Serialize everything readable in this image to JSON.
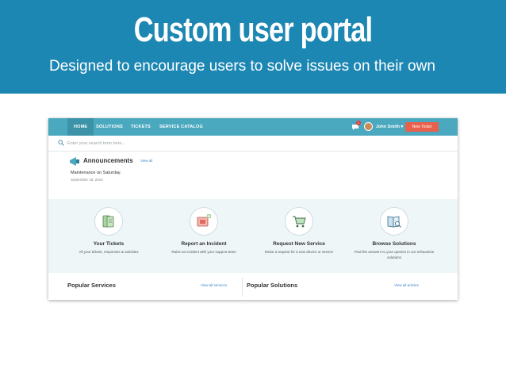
{
  "slide": {
    "title": "Custom user portal",
    "subtitle": "Designed to encourage users to solve issues on their own"
  },
  "portal": {
    "nav": {
      "items": [
        "HOME",
        "SOLUTIONS",
        "TICKETS",
        "SERVICE CATALOG"
      ],
      "active": "HOME",
      "notification_count": "1",
      "user_name": "John Smith ▾",
      "new_ticket_label": "New Ticket"
    },
    "search": {
      "placeholder": "Enter your search term here..."
    },
    "announcements": {
      "title": "Announcements",
      "view_all": "View all",
      "item_title": "Maintenance on Saturday.",
      "item_date": "September 18, 2014"
    },
    "cards": [
      {
        "title": "Your Tickets",
        "desc": "All your tickets, responses & activities",
        "icon": "tickets-icon"
      },
      {
        "title": "Report an Incident",
        "desc": "Raise an incident with your support team",
        "icon": "report-incident-icon"
      },
      {
        "title": "Request New Service",
        "desc": "Raise a request for a new device or service",
        "icon": "cart-icon"
      },
      {
        "title": "Browse Solutions",
        "desc": "Find the answers to your queries in our exhaustive solutions",
        "icon": "book-search-icon"
      }
    ],
    "popular_services": {
      "title": "Popular Services",
      "link": "View all services"
    },
    "popular_solutions": {
      "title": "Popular Solutions",
      "link": "View all articles"
    }
  },
  "colors": {
    "banner": "#1d87b3",
    "nav": "#4aa8bf",
    "new_ticket": "#e8604c",
    "cards_bg": "#eef6f8",
    "link": "#3a86c8"
  }
}
